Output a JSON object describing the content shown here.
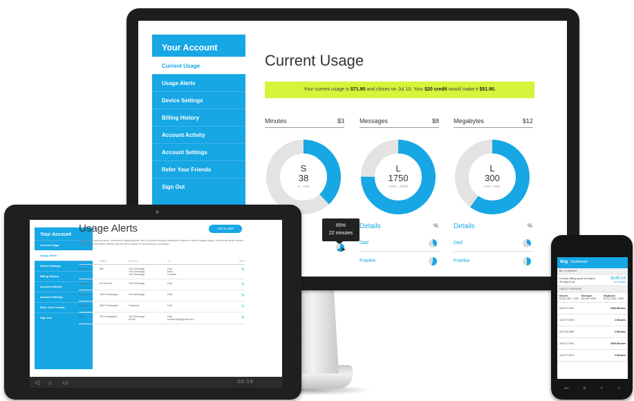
{
  "colors": {
    "accent": "#16a7e4",
    "banner": "#d7f33a",
    "donut_track": "#e3e3e3",
    "bezel": "#1c1d1f"
  },
  "monitor": {
    "sidebar": {
      "title": "Your Account",
      "items": [
        {
          "label": "Current Usage",
          "active": true
        },
        {
          "label": "Usage Alerts"
        },
        {
          "label": "Device Settings"
        },
        {
          "label": "Billing History"
        },
        {
          "label": "Account Activity"
        },
        {
          "label": "Account Settings"
        },
        {
          "label": "Refer Your Friends"
        },
        {
          "label": "Sign Out"
        }
      ]
    },
    "title": "Current Usage",
    "banner": {
      "prefix": "Your current usage is ",
      "usage": "$71.90",
      "middle": " and closes on Jul 10. Your ",
      "credit": "$20 credit",
      "suffix": " would make it ",
      "final": "$51.90."
    },
    "columns": [
      {
        "name": "Minutes",
        "cost": "$3",
        "tier": "S",
        "value": "38",
        "range": "(1 - 100)",
        "fill": 0.38
      },
      {
        "name": "Messages",
        "cost": "$8",
        "tier": "L",
        "value": "1750",
        "range": "(1001 - 2000)",
        "fill": 0.75
      },
      {
        "name": "Megabytes",
        "cost": "$12",
        "tier": "L",
        "value": "300",
        "range": "(101 - 500)",
        "fill": 0.6
      }
    ],
    "details": {
      "label": "Details",
      "pct": "%",
      "rows": [
        "Dad",
        "Frankie"
      ]
    },
    "tooltip": {
      "pct": "65%",
      "detail": "22 minutes"
    }
  },
  "tablet": {
    "sidebar": {
      "title": "Your Account",
      "items": [
        {
          "label": "Current Usage"
        },
        {
          "label": "Usage Alerts",
          "active": true
        },
        {
          "label": "Device Settings"
        },
        {
          "label": "Billing History"
        },
        {
          "label": "Account Activity"
        },
        {
          "label": "Account Settings"
        },
        {
          "label": "Refer Your Friends"
        },
        {
          "label": "Sign Out"
        }
      ]
    },
    "title": "Usage Alerts",
    "add_button": "Add an alert",
    "description": "Lorem ipsum dolor sit amet, consectetur adipisicing elit, sed do eiusmod tempor incididunt ut labore et dolore magna aliqua. Ut enim ad minim veniam, quis nostrud exercitation ullamco laboris nisi ut aliquip ex ea commodo consequat.",
    "table": {
      "headers": [
        "WHO ▾",
        "WHEN",
        "ACTION",
        "TO",
        "EDIT"
      ],
      "rows": [
        {
          "who": "Account",
          "when": "$60",
          "action": "Text Message\nText Message\nText Message",
          "to": "Dad\nMom\nFrankie"
        },
        {
          "who": "Account",
          "when": "50 Minutes",
          "action": "Text Message",
          "to": "Dad"
        },
        {
          "who": "Frankie",
          "when": "1500 Messages",
          "action": "Text Message",
          "to": "Dad"
        },
        {
          "who": "Frankie",
          "when": "3000 Messages",
          "action": "Suspend",
          "to": "Dad"
        },
        {
          "who": "Mom",
          "when": "200 Megabytes",
          "action": "Text Message\nEmail",
          "to": "Dad\nsomebody@gmail.com"
        }
      ]
    },
    "clock": "02:14"
  },
  "phone": {
    "brand": "ting",
    "screen": "Dashboard",
    "bill_summary": "BILL SUMMARY",
    "billing_text": "Current billing cycle ending in 29 days is at",
    "billing_amount": "$245.04",
    "see_details": "See details",
    "usage_overview": "USAGE OVERVIEW",
    "usage": [
      {
        "label": "Minutes",
        "detail": "$3 (S) 1000 - 1200"
      },
      {
        "label": "Messages",
        "detail": "$14 (M) 10000"
      },
      {
        "label": "Megabytes",
        "detail": "$12 (L) 2000 - 3000"
      }
    ],
    "lines": [
      {
        "number": "324.077.3201",
        "usage": "2808 Minutes"
      },
      {
        "number": "324.077.8073",
        "usage": "3 Minutes"
      },
      {
        "number": "324.390.4862",
        "usage": "3 Minutes"
      },
      {
        "number": "324.077.3201",
        "usage": "2808 Minutes"
      },
      {
        "number": "324.077.8073",
        "usage": "3 Minutes"
      }
    ]
  }
}
